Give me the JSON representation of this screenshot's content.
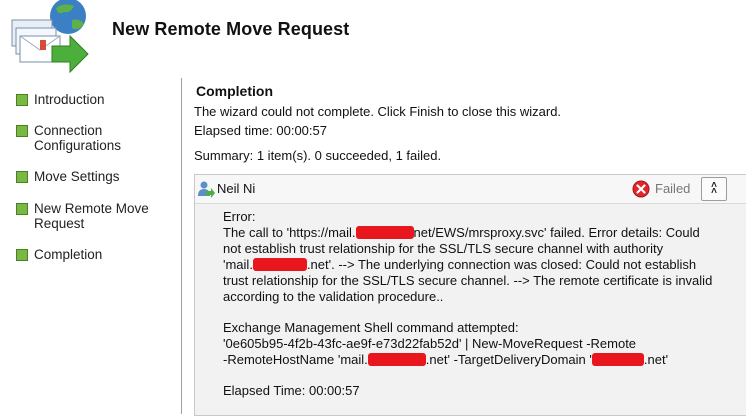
{
  "header": {
    "title": "New Remote Move Request",
    "icon": "exchange-wizard-icon"
  },
  "steps": [
    {
      "label": "Introduction"
    },
    {
      "label": "Connection Configurations"
    },
    {
      "label": "Move Settings"
    },
    {
      "label": "New Remote Move Request"
    },
    {
      "label": "Completion"
    }
  ],
  "content": {
    "section_title": "Completion",
    "message": "The wizard could not complete. Click Finish to close this wizard.",
    "elapsed_time": "Elapsed time: 00:00:57",
    "summary": "Summary: 1 item(s). 0 succeeded, 1 failed."
  },
  "result": {
    "user_name": "Neil Ni",
    "status": "Failed",
    "status_color": "#e0262a",
    "collapse_glyph": "˄",
    "error_lines": {
      "l1": "Error:",
      "l2a": "The call to 'https://mail.",
      "l2b": "net/EWS/mrsproxy.svc' failed. Error details: Could",
      "l3": "not establish trust relationship for the SSL/TLS secure channel with authority",
      "l4a": "'mail.",
      "l4b": ".net'. --> The underlying connection was closed: Could not establish",
      "l5": "trust relationship for the SSL/TLS secure channel. --> The remote certificate is invalid",
      "l6": "according to the validation procedure..",
      "l7": "Exchange Management Shell command attempted:",
      "l8": "'0e605b95-4f2b-43fc-ae9f-e73d22fab52d' | New-MoveRequest -Remote",
      "l9a": "-RemoteHostName 'mail.",
      "l9b": ".net' -TargetDeliveryDomain '",
      "l9c": ".net'",
      "l10": "Elapsed Time: 00:00:57"
    }
  }
}
